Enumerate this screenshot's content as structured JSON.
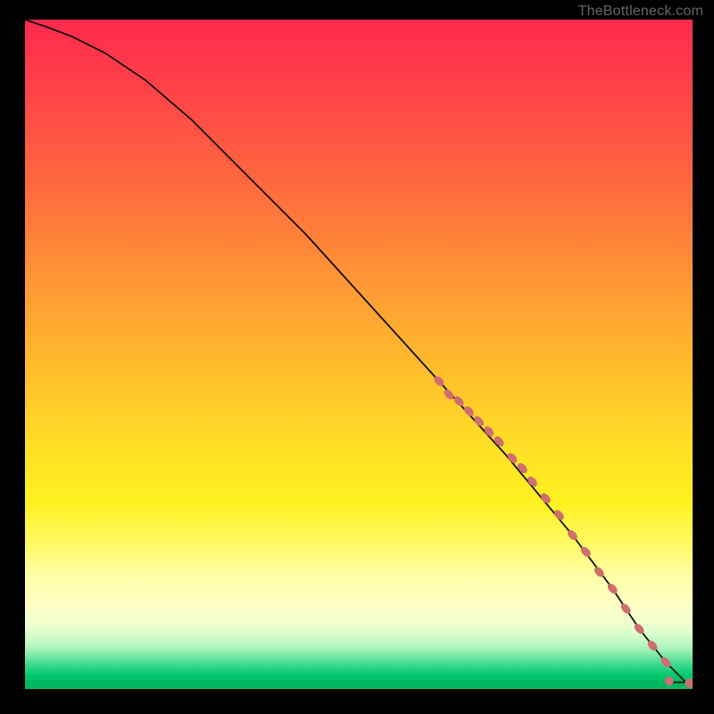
{
  "watermark": "TheBottleneck.com",
  "chart_data": {
    "type": "line",
    "title": "",
    "xlabel": "",
    "ylabel": "",
    "xlim": [
      0,
      100
    ],
    "ylim": [
      0,
      100
    ],
    "background_gradient_colors": [
      "#ff2a4d",
      "#ff9a34",
      "#ffe225",
      "#fdffc8",
      "#00b85f"
    ],
    "series": [
      {
        "name": "bottleneck-curve",
        "x": [
          0,
          3,
          7,
          12,
          18,
          25,
          33,
          42,
          52,
          62,
          72,
          82,
          88,
          92,
          96,
          99,
          100
        ],
        "y": [
          100,
          99,
          97.5,
          95,
          91,
          85,
          77,
          68,
          57,
          46,
          35,
          23,
          15,
          9,
          4,
          1,
          0.8
        ]
      }
    ],
    "markers": {
      "name": "bottleneck-points",
      "color": "#cf6e6e",
      "x": [
        62,
        63.5,
        65,
        66.5,
        68,
        69.5,
        71,
        73,
        74.5,
        76,
        78,
        80,
        82,
        84,
        86,
        88,
        90,
        92,
        94,
        96
      ],
      "y": [
        46,
        44,
        43,
        41.5,
        40,
        38.5,
        37,
        34.5,
        33,
        31,
        28.5,
        26,
        23,
        20.5,
        17.5,
        15,
        12,
        9,
        6.5,
        4
      ]
    },
    "end_cluster": {
      "name": "final-cluster",
      "color": "#cf6e6e",
      "points": [
        {
          "x": 96.5,
          "y": 1.2
        },
        {
          "x": 99.5,
          "y": 0.9
        },
        {
          "x": 100,
          "y": 0.8
        }
      ]
    }
  }
}
